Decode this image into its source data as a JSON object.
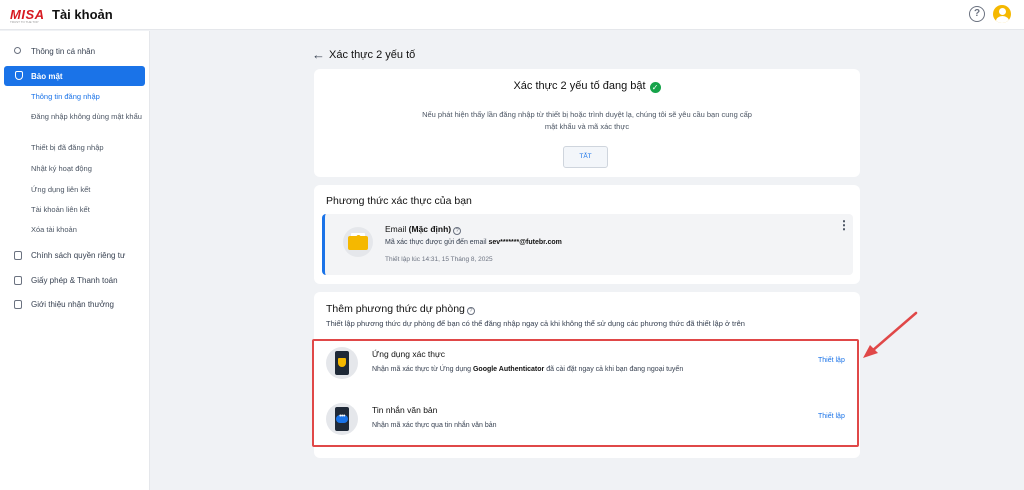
{
  "header": {
    "logo_text": "MISA",
    "logo_sub": "TRUST TO THE TOP",
    "title": "Tài khoản",
    "help_icon": "question-circle-icon",
    "avatar_icon": "user-avatar-icon",
    "brand_color": "#d71920",
    "avatar_color": "#f5b800"
  },
  "sidebar": {
    "items": [
      {
        "label": "Thông tin cá nhân",
        "icon": "person-icon"
      },
      {
        "label": "Bảo mật",
        "icon": "shield-icon"
      },
      {
        "label": "Chính sách quyền riêng tư",
        "icon": "document-icon"
      },
      {
        "label": "Giấy phép & Thanh toán",
        "icon": "license-icon"
      },
      {
        "label": "Giới thiệu nhận thưởng",
        "icon": "gift-icon"
      }
    ],
    "security_subitems": [
      "Thông tin đăng nhập",
      "Đăng nhập không dùng mật khẩu",
      "Thiết bị đã đăng nhập",
      "Nhật ký hoạt động",
      "Ứng dụng liên kết",
      "Tài khoản liên kết",
      "Xóa tài khoản"
    ],
    "active_color": "#1a73e8"
  },
  "page": {
    "back_icon": "arrow-left-icon",
    "title": "Xác thực 2 yếu tố"
  },
  "status_card": {
    "title": "Xác thực 2 yếu tố đang bật",
    "check_icon": "check-circle-icon",
    "check_glyph": "✓",
    "description": "Nếu phát hiện thấy lần đăng nhập từ thiết bị hoặc trình duyệt lạ, chúng tôi sẽ yêu cầu bạn cung cấp mật khẩu và mã xác thực",
    "off_button": "TẮT",
    "status_color": "#16a34a"
  },
  "methods_card": {
    "title": "Phương thức xác thực của bạn",
    "method": {
      "icon": "email-envelope-icon",
      "name": "Email",
      "name_suffix": "(Mặc định)",
      "description_prefix": "Mã xác thực được gửi đến email",
      "email": "sev*******@futebr.com",
      "setup_time": "Thiết lập lúc 14:31, 15 Tháng 8, 2025",
      "menu_icon": "more-vertical-icon",
      "menu_glyph": "⋮"
    }
  },
  "backup_card": {
    "title": "Thêm phương thức dự phòng",
    "subtitle": "Thiết lập phương thức dự phòng để bạn có thể đăng nhập ngay cả khi không thể sử dụng các phương thức đã thiết lập ở trên",
    "options": [
      {
        "icon": "authenticator-app-icon",
        "title": "Ứng dụng xác thực",
        "desc_prefix": "Nhận mã xác thực từ Ứng dụng",
        "desc_bold": "Google Authenticator",
        "desc_suffix": "đã cài đặt ngay cả khi bạn đang ngoại tuyến",
        "action": "Thiết lập"
      },
      {
        "icon": "sms-message-icon",
        "title": "Tin nhắn văn bản",
        "desc_prefix": "Nhận mã xác thực qua tin nhắn văn bản",
        "action": "Thiết lập",
        "bubble_glyph": "•••"
      }
    ]
  },
  "annotation": {
    "highlight_color": "#e04848",
    "arrow_icon": "red-pointer-arrow-icon"
  },
  "glyphs": {
    "back": "←",
    "help": "?"
  }
}
